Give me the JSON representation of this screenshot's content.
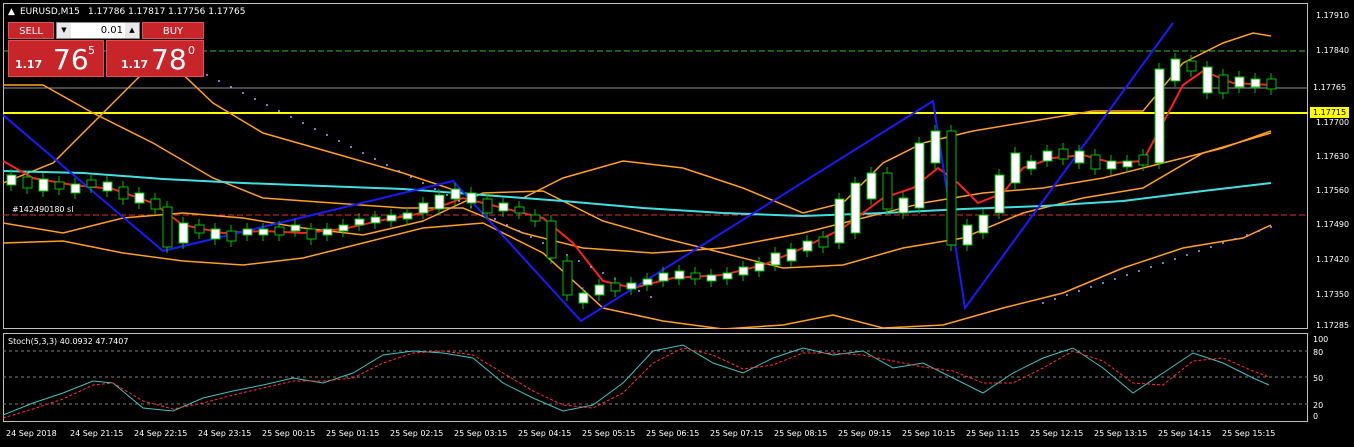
{
  "header": {
    "symbol": "EURUSD,M15",
    "ohlc": "1.17786 1.17817 1.17756 1.17765",
    "collapse_glyph": "▲"
  },
  "one_click": {
    "sell_label": "SELL",
    "buy_label": "BUY",
    "lot_value": "0.01",
    "sell_price_prefix": "1.17",
    "sell_price_big": "76",
    "sell_price_sup": "5",
    "buy_price_prefix": "1.17",
    "buy_price_big": "78",
    "buy_price_sup": "0"
  },
  "annotations": {
    "order_line_label": "#142490180 sl",
    "highlight_price": "1.17715",
    "current_price": "1.17765"
  },
  "price_axis": [
    "1.17910",
    "1.17840",
    "1.17765",
    "1.17700",
    "1.17630",
    "1.17560",
    "1.17490",
    "1.17420",
    "1.17350",
    "1.17285"
  ],
  "stoch": {
    "label": "Stoch(5,3,3) 40.0932 47.7407",
    "axis": [
      "100",
      "80",
      "50",
      "20",
      "0"
    ]
  },
  "time_axis": [
    "24 Sep 2018",
    "24 Sep 21:15",
    "24 Sep 22:15",
    "24 Sep 23:15",
    "25 Sep 00:15",
    "25 Sep 01:15",
    "25 Sep 02:15",
    "25 Sep 03:15",
    "25 Sep 04:15",
    "25 Sep 05:15",
    "25 Sep 06:15",
    "25 Sep 07:15",
    "25 Sep 08:15",
    "25 Sep 09:15",
    "25 Sep 10:15",
    "25 Sep 11:15",
    "25 Sep 12:15",
    "25 Sep 13:15",
    "25 Sep 14:15",
    "25 Sep 15:15"
  ],
  "colors": {
    "background": "#000000",
    "bull_candle": "#ffffff",
    "bear_candle": "#000000",
    "wick": "#00c000",
    "highlight_line": "#ffff00",
    "zigzag": "#1a1aff",
    "ma_red": "#ff2020",
    "ma_cyan": "#40e0e0",
    "envelope": "#ffa020",
    "stoch_main": "#40c0c0",
    "stoch_signal": "#ff3030"
  }
}
